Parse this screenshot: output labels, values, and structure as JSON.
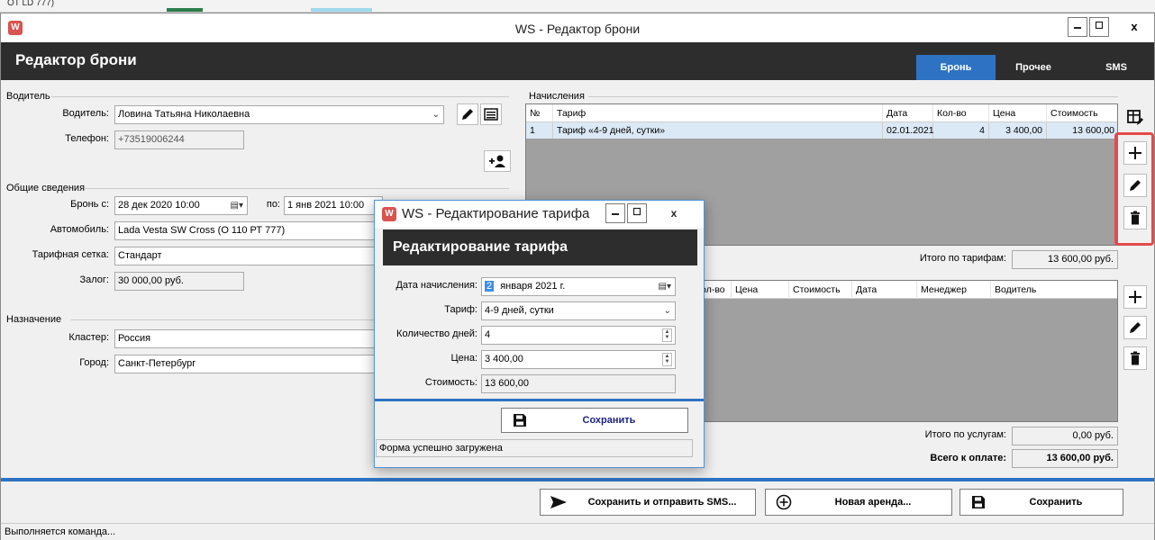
{
  "background_app": {
    "fragment": "OT LD 777)"
  },
  "window": {
    "title": "WS - Редактор брони",
    "app_icon": "ws-logo-icon",
    "controls": [
      "_",
      "□",
      "X"
    ]
  },
  "header": {
    "title": "Редактор брони",
    "tabs": [
      {
        "label": "Бронь",
        "active": true
      },
      {
        "label": "Прочее",
        "active": false
      },
      {
        "label": "SMS",
        "active": false
      }
    ]
  },
  "driver_section": {
    "group_label": "Водитель",
    "driver_label": "Водитель:",
    "driver_value": "Ловина Татьяна Николаевна",
    "phone_label": "Телефон:",
    "phone_value": "+73519006244"
  },
  "general_section": {
    "group_label": "Общие сведения",
    "booking_from_label": "Бронь с:",
    "booking_from_value": "28 дек 2020  10:00",
    "booking_to_label": "по:",
    "booking_to_value": "1 янв 2021  10:00",
    "car_label": "Автомобиль:",
    "car_value": "Lada Vesta SW Cross (О 110 РТ 777)",
    "tariff_grid_label": "Тарифная сетка:",
    "tariff_grid_value": "Стандарт",
    "deposit_label": "Залог:",
    "deposit_value": "30 000,00 руб."
  },
  "destination_section": {
    "group_label": "Назначение",
    "cluster_label": "Кластер:",
    "cluster_value": "Россия",
    "city_label": "Город:",
    "city_value": "Санкт-Петербург"
  },
  "charges_section": {
    "group_label": "Начисления",
    "columns": [
      "№",
      "Тариф",
      "Дата",
      "Кол-во",
      "Цена",
      "Стоимость"
    ],
    "rows": [
      {
        "num": "1",
        "tariff": "Тариф «4-9 дней, сутки»",
        "date": "02.01.2021",
        "qty": "4",
        "price": "3 400,00",
        "cost": "13 600,00"
      }
    ],
    "total_label": "Итого по тарифам:",
    "total_value": "13 600,00 руб."
  },
  "services_section": {
    "columns": [
      "Кол-во",
      "Цена",
      "Стоимость",
      "Дата",
      "Менеджер",
      "Водитель"
    ],
    "total_label": "Итого по услугам:",
    "total_value": "0,00 руб.",
    "grand_total_label": "Всего к оплате:",
    "grand_total_value": "13 600,00 руб."
  },
  "footer": {
    "save_send_sms": "Сохранить и отправить SMS...",
    "new_rental": "Новая аренда...",
    "save": "Сохранить"
  },
  "status": {
    "text": "Выполняется команда..."
  },
  "dialog": {
    "title": "WS - Редактирование тарифа",
    "header": "Редактирование тарифа",
    "charge_date_label": "Дата начисления:",
    "charge_date_day": "2",
    "charge_date_rest": "января  2021 г.",
    "tariff_label": "Тариф:",
    "tariff_value": "4-9 дней, сутки",
    "days_label": "Количество дней:",
    "days_value": "4",
    "price_label": "Цена:",
    "price_value": "3 400,00",
    "cost_label": "Стоимость:",
    "cost_value": "13 600,00",
    "save_label": "Сохранить",
    "status_text": "Форма успешно загружена"
  },
  "colors": {
    "header_bg": "#2d2d2d",
    "accent_blue": "#2e73c3",
    "highlight_red": "#e24b4b",
    "selected_row": "#dbe8f5",
    "grid_empty": "#a0a0a0"
  }
}
